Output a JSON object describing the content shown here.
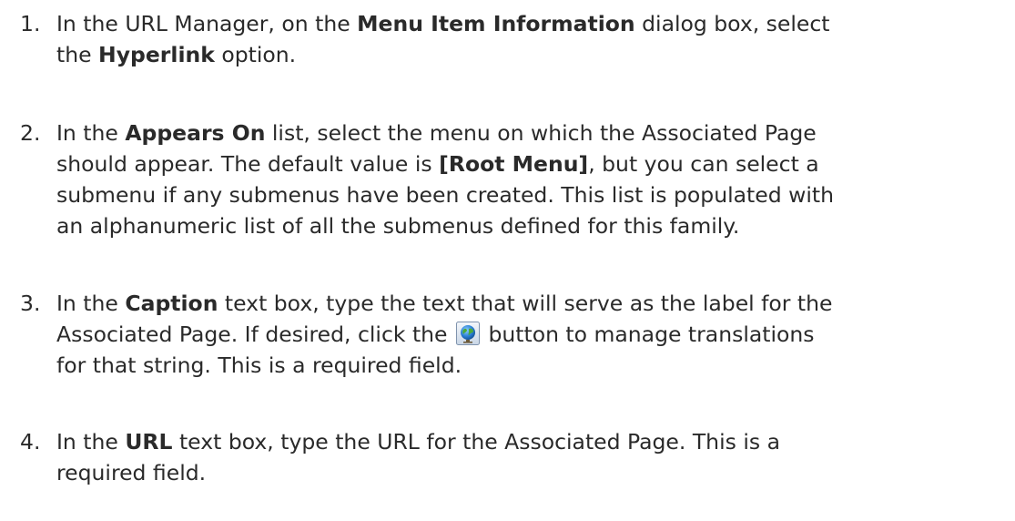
{
  "steps": [
    {
      "number": "1.",
      "line1": {
        "p1": "In the URL Manager, on the ",
        "b1": "Menu Item Information",
        "p2": " dialog box, select"
      },
      "line2": {
        "p1": "the ",
        "b1": "Hyperlink",
        "p2": " option."
      }
    },
    {
      "number": "2.",
      "line1": {
        "p1": "In the ",
        "b1": "Appears On",
        "p2": " list, select the menu on which the Associated Page"
      },
      "line2": {
        "p1": "should appear. The default value is ",
        "b1": "[Root Menu]",
        "p2": ", but you can select a"
      },
      "line3": "submenu if any submenus have been created. This list is populated with",
      "line4": "an alphanumeric list of all the submenus defined for this family."
    },
    {
      "number": "3.",
      "line1": {
        "p1": "In the ",
        "b1": "Caption",
        "p2": " text box, type the text that will serve as the label for the"
      },
      "line2": {
        "p1": "Associated Page. If desired, click the ",
        "p2": " button to manage translations"
      },
      "line3": "for that string. This is a required field.",
      "button_icon": "globe-icon"
    },
    {
      "number": "4.",
      "line1": {
        "p1": "In the ",
        "b1": "URL",
        "p2": " text box, type the URL for the Associated Page. This is a"
      },
      "line2": "required field."
    }
  ]
}
